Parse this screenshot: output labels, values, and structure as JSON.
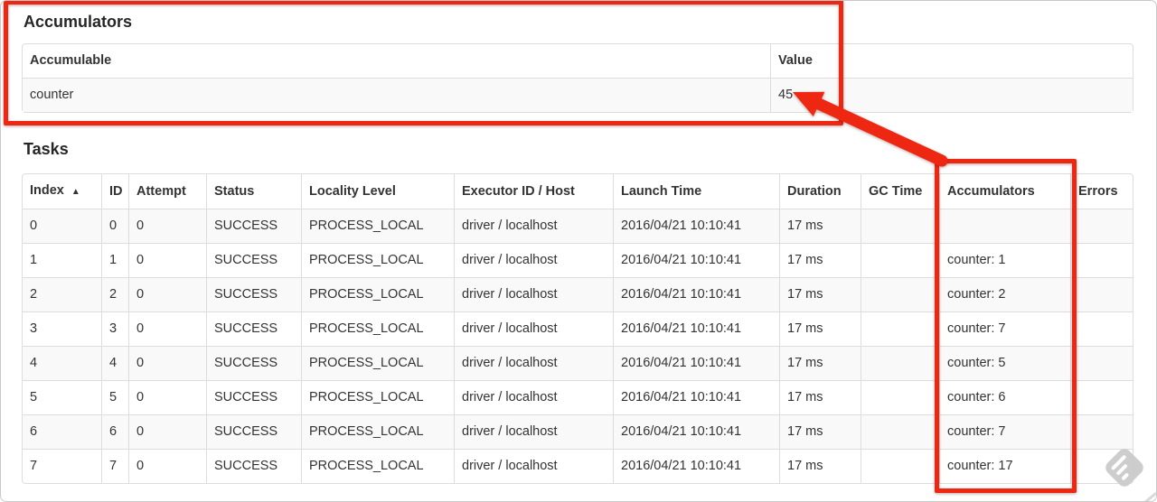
{
  "accumulators_section": {
    "title": "Accumulators",
    "table": {
      "headers": [
        "Accumulable",
        "Value"
      ],
      "rows": [
        [
          "counter",
          "45"
        ]
      ]
    }
  },
  "tasks_section": {
    "title": "Tasks",
    "sort": {
      "column": "Index",
      "direction": "ascending",
      "glyph": "▲"
    },
    "table": {
      "headers": [
        "Index",
        "ID",
        "Attempt",
        "Status",
        "Locality Level",
        "Executor ID / Host",
        "Launch Time",
        "Duration",
        "GC Time",
        "Accumulators",
        "Errors"
      ],
      "rows": [
        [
          "0",
          "0",
          "0",
          "SUCCESS",
          "PROCESS_LOCAL",
          "driver / localhost",
          "2016/04/21 10:10:41",
          "17 ms",
          "",
          "",
          ""
        ],
        [
          "1",
          "1",
          "0",
          "SUCCESS",
          "PROCESS_LOCAL",
          "driver / localhost",
          "2016/04/21 10:10:41",
          "17 ms",
          "",
          "counter: 1",
          ""
        ],
        [
          "2",
          "2",
          "0",
          "SUCCESS",
          "PROCESS_LOCAL",
          "driver / localhost",
          "2016/04/21 10:10:41",
          "17 ms",
          "",
          "counter: 2",
          ""
        ],
        [
          "3",
          "3",
          "0",
          "SUCCESS",
          "PROCESS_LOCAL",
          "driver / localhost",
          "2016/04/21 10:10:41",
          "17 ms",
          "",
          "counter: 7",
          ""
        ],
        [
          "4",
          "4",
          "0",
          "SUCCESS",
          "PROCESS_LOCAL",
          "driver / localhost",
          "2016/04/21 10:10:41",
          "17 ms",
          "",
          "counter: 5",
          ""
        ],
        [
          "5",
          "5",
          "0",
          "SUCCESS",
          "PROCESS_LOCAL",
          "driver / localhost",
          "2016/04/21 10:10:41",
          "17 ms",
          "",
          "counter: 6",
          ""
        ],
        [
          "6",
          "6",
          "0",
          "SUCCESS",
          "PROCESS_LOCAL",
          "driver / localhost",
          "2016/04/21 10:10:41",
          "17 ms",
          "",
          "counter: 7",
          ""
        ],
        [
          "7",
          "7",
          "0",
          "SUCCESS",
          "PROCESS_LOCAL",
          "driver / localhost",
          "2016/04/21 10:10:41",
          "17 ms",
          "",
          "counter: 17",
          ""
        ]
      ]
    }
  },
  "annotations": {
    "highlight_color": "#ee2713",
    "boxed_regions": [
      "accumulators-summary-section",
      "accumulators-task-column"
    ],
    "arrow_points_to": "45"
  }
}
